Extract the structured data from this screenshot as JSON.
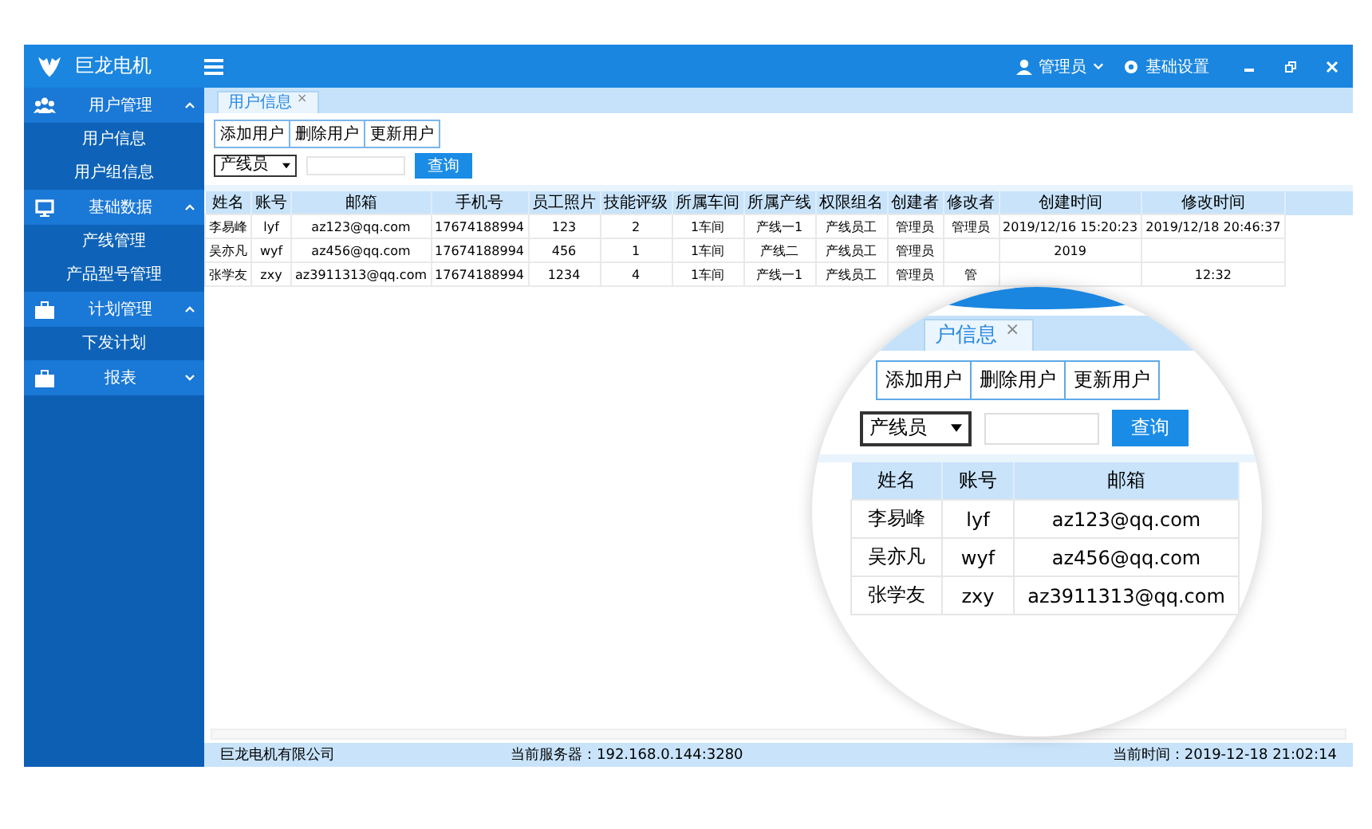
{
  "app": {
    "title": "巨龙电机"
  },
  "header": {
    "user": "管理员",
    "settings": "基础设置"
  },
  "sidebar": {
    "groups": [
      {
        "label": "用户管理",
        "expanded": true,
        "children": [
          {
            "label": "用户信息"
          },
          {
            "label": "用户组信息"
          }
        ]
      },
      {
        "label": "基础数据",
        "expanded": true,
        "children": [
          {
            "label": "产线管理"
          },
          {
            "label": "产品型号管理"
          }
        ]
      },
      {
        "label": "计划管理",
        "expanded": true,
        "children": [
          {
            "label": "下发计划"
          }
        ]
      },
      {
        "label": "报表",
        "expanded": false
      }
    ]
  },
  "tabs": [
    {
      "label": "用户信息",
      "selected": true,
      "close": "×"
    }
  ],
  "toolbar": {
    "buttons": [
      "添加用户",
      "删除用户",
      "更新用户"
    ]
  },
  "filter": {
    "select": "产线员",
    "query_button": "查询"
  },
  "table": {
    "columns": [
      "姓名",
      "账号",
      "邮箱",
      "手机号",
      "员工照片",
      "技能评级",
      "所属车间",
      "所属产线",
      "权限组名",
      "创建者",
      "修改者",
      "创建时间",
      "修改时间"
    ],
    "rows": [
      [
        "李易峰",
        "lyf",
        "az123@qq.com",
        "17674188994",
        "123",
        "2",
        "1车间",
        "产线一1",
        "产线员工",
        "管理员",
        "管理员",
        "2019/12/16 15:20:23",
        "2019/12/18 20:46:37"
      ],
      [
        "吴亦凡",
        "wyf",
        "az456@qq.com",
        "17674188994",
        "456",
        "1",
        "1车间",
        "产线二",
        "产线员工",
        "管理员",
        null,
        "2019",
        null
      ],
      [
        "张学友",
        "zxy",
        "az3911313@qq.com",
        "17674188994",
        "1234",
        "4",
        "1车间",
        "产线一1",
        "产线员工",
        "管理员",
        "管",
        null,
        "12:32"
      ]
    ]
  },
  "status_bar": {
    "company": "巨龙电机有限公司",
    "server": "当前服务器：192.168.0.144:3280",
    "time": "当前时间：2019-12-18 21:02:14"
  },
  "magnifier": {
    "tab": "户信息",
    "close": "×",
    "buttons": [
      "添加用户",
      "删除用户",
      "更新用户"
    ],
    "select": "产线员",
    "query_button": "查询",
    "columns": [
      "姓名",
      "账号",
      "邮箱"
    ],
    "rows": [
      [
        "李易峰",
        "lyf",
        "az123@qq.com"
      ],
      [
        "吴亦凡",
        "wyf",
        "az456@qq.com"
      ],
      [
        "张学友",
        "zxy",
        "az3911313@qq.com"
      ]
    ]
  }
}
